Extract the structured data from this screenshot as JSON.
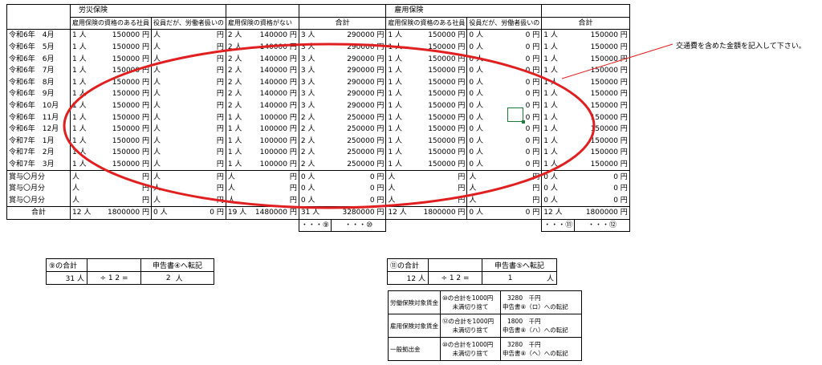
{
  "headers": {
    "rousai": "労災保険",
    "koyou": "雇用保険",
    "cols": [
      "雇用保険の資格のある社員",
      "役員だが、労働者扱いの",
      "雇用保険の資格がない",
      "合計",
      "雇用保険の資格のある社員",
      "役員だが、労働者扱いの",
      "合計"
    ]
  },
  "rows": [
    {
      "label": "令和6年　4月",
      "c": [
        "1 人",
        "150000 円",
        "人",
        "円",
        "2 人",
        "140000 円",
        "3 人",
        "290000 円",
        "1 人",
        "150000 円",
        "0 人",
        "0 円",
        "1 人",
        "150000 円"
      ]
    },
    {
      "label": "令和6年　5月",
      "c": [
        "1 人",
        "150000 円",
        "人",
        "円",
        "2 人",
        "140000 円",
        "3 人",
        "290000 円",
        "1 人",
        "150000 円",
        "0 人",
        "0 円",
        "1 人",
        "150000 円"
      ]
    },
    {
      "label": "令和6年　6月",
      "c": [
        "1 人",
        "150000 円",
        "人",
        "円",
        "2 人",
        "140000 円",
        "3 人",
        "290000 円",
        "1 人",
        "150000 円",
        "0 人",
        "0 円",
        "1 人",
        "150000 円"
      ]
    },
    {
      "label": "令和6年　7月",
      "c": [
        "1 人",
        "150000 円",
        "人",
        "円",
        "2 人",
        "140000 円",
        "3 人",
        "290000 円",
        "1 人",
        "150000 円",
        "0 人",
        "0 円",
        "1 人",
        "150000 円"
      ]
    },
    {
      "label": "令和6年　8月",
      "c": [
        "1 人",
        "150000 円",
        "人",
        "円",
        "2 人",
        "140000 円",
        "3 人",
        "290000 円",
        "1 人",
        "150000 円",
        "0 人",
        "0 円",
        "1 人",
        "150000 円"
      ]
    },
    {
      "label": "令和6年　9月",
      "c": [
        "1 人",
        "150000 円",
        "人",
        "円",
        "2 人",
        "140000 円",
        "3 人",
        "290000 円",
        "1 人",
        "150000 円",
        "0 人",
        "0 円",
        "1 人",
        "150000 円"
      ]
    },
    {
      "label": "令和6年　10月",
      "c": [
        "1 人",
        "150000 円",
        "人",
        "円",
        "2 人",
        "140000 円",
        "3 人",
        "290000 円",
        "1 人",
        "150000 円",
        "0 人",
        "0 円",
        "1 人",
        "150000 円"
      ]
    },
    {
      "label": "令和6年　11月",
      "c": [
        "1 人",
        "150000 円",
        "人",
        "円",
        "1 人",
        "100000 円",
        "2 人",
        "250000 円",
        "1 人",
        "150000 円",
        "0 人",
        "0 円",
        "1 人",
        "150000 円"
      ]
    },
    {
      "label": "令和6年　12月",
      "c": [
        "1 人",
        "150000 円",
        "人",
        "円",
        "1 人",
        "100000 円",
        "2 人",
        "250000 円",
        "1 人",
        "150000 円",
        "0 人",
        "0 円",
        "1 人",
        "150000 円"
      ]
    },
    {
      "label": "令和7年　1月",
      "c": [
        "1 人",
        "150000 円",
        "人",
        "円",
        "1 人",
        "100000 円",
        "2 人",
        "250000 円",
        "1 人",
        "150000 円",
        "0 人",
        "0 円",
        "1 人",
        "150000 円"
      ]
    },
    {
      "label": "令和7年　2月",
      "c": [
        "1 人",
        "150000 円",
        "人",
        "円",
        "1 人",
        "100000 円",
        "2 人",
        "250000 円",
        "1 人",
        "150000 円",
        "0 人",
        "0 円",
        "1 人",
        "150000 円"
      ]
    },
    {
      "label": "令和7年　3月",
      "c": [
        "1 人",
        "150000 円",
        "人",
        "円",
        "1 人",
        "100000 円",
        "2 人",
        "250000 円",
        "1 人",
        "150000 円",
        "0 人",
        "0 円",
        "1 人",
        "150000 円"
      ]
    },
    {
      "label": "賞与〇月分",
      "c": [
        "人",
        "円",
        "人",
        "円",
        "人",
        "円",
        "0 人",
        "0 円",
        "人",
        "円",
        "人",
        "円",
        "0 人",
        "0 円"
      ]
    },
    {
      "label": "賞与〇月分",
      "c": [
        "人",
        "円",
        "人",
        "円",
        "人",
        "円",
        "0 人",
        "0 円",
        "人",
        "円",
        "人",
        "円",
        "0 人",
        "0 円"
      ]
    },
    {
      "label": "賞与〇月分",
      "c": [
        "人",
        "円",
        "人",
        "円",
        "人",
        "円",
        "0 人",
        "0 円",
        "人",
        "円",
        "人",
        "円",
        "0 人",
        "0 円"
      ]
    },
    {
      "label": "合計",
      "c": [
        "12 人",
        "1800000 円",
        "0 人",
        "0 円",
        "19 人",
        "1480000 円",
        "31 人",
        "3280000 円",
        "12 人",
        "1800000 円",
        "0 人",
        "0 円",
        "12 人",
        "1800000 円"
      ]
    }
  ],
  "markers": {
    "m9": "・・・⑨",
    "m10": "・・・⑩",
    "m11": "・・・⑪",
    "m12": "・・・⑫"
  },
  "note": "交通費を含めた金額を記入して下さい。",
  "left_box": {
    "h1": "⑨の合計",
    "h3": "申告書④へ転記",
    "v1": "31 人",
    "op": "÷ 1 2 =",
    "v2": "2",
    "unit": "人"
  },
  "right_box": {
    "h1": "⑪の合計",
    "h3": "申告書⑤へ転記",
    "v1": "12 人",
    "op": "÷ 1 2 =",
    "v2": "1",
    "unit": "人"
  },
  "bottom": [
    {
      "a": "労働保険対象賃金",
      "b1": "⑩の合計を1000円",
      "b2": "未満切り捨て",
      "c1": "3280　千円",
      "c2": "申告書⑧（ロ）への転記"
    },
    {
      "a": "雇用保険対象賃金",
      "b1": "⑫の合計を1000円",
      "b2": "未満切り捨て",
      "c1": "1800　千円",
      "c2": "申告書⑧（ハ）への転記"
    },
    {
      "a": "一般拠出金",
      "b1": "⑩の合計を1000円",
      "b2": "未満切り捨て",
      "c1": "3280　千円",
      "c2": "申告書⑧（ヘ）への転記"
    }
  ],
  "colors": {
    "ellipse": "#e02020",
    "selection": "#1f7a3a"
  }
}
